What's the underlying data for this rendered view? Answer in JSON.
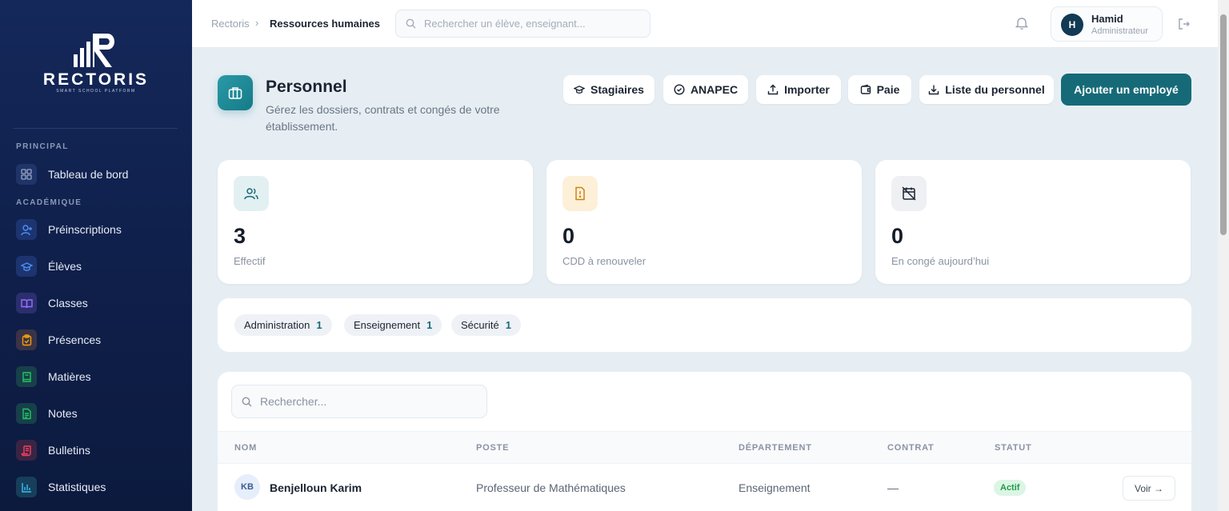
{
  "brand": {
    "name": "RECTORIS",
    "tagline": "SMART SCHOOL PLATFORM"
  },
  "sidebar": {
    "sections": [
      {
        "label": "PRINCIPAL"
      },
      {
        "label": "ACADÉMIQUE"
      }
    ],
    "items": [
      {
        "label": "Tableau de bord",
        "icon": "grid-icon"
      },
      {
        "label": "Préinscriptions",
        "icon": "user-plus-icon"
      },
      {
        "label": "Élèves",
        "icon": "graduation-cap-icon"
      },
      {
        "label": "Classes",
        "icon": "book-open-icon"
      },
      {
        "label": "Présences",
        "icon": "clipboard-check-icon"
      },
      {
        "label": "Matières",
        "icon": "book-icon"
      },
      {
        "label": "Notes",
        "icon": "file-text-icon"
      },
      {
        "label": "Bulletins",
        "icon": "scroll-icon"
      },
      {
        "label": "Statistiques",
        "icon": "bar-chart-icon"
      }
    ],
    "colors": {
      "background": "#14285a",
      "grid": "#9aa7c4",
      "user-plus": "#4f8ff7",
      "graduation-cap": "#4f8ff7",
      "book-open": "#9a6bff",
      "clipboard": "#f59e0b",
      "book": "#22c55e",
      "file-text": "#22c55e",
      "scroll": "#f43f5e",
      "bar-chart": "#38bdf8"
    }
  },
  "topbar": {
    "breadcrumb": [
      "Rectoris",
      "Ressources humaines"
    ],
    "search_placeholder": "Rechercher un élève, enseignant...",
    "user": {
      "initial": "H",
      "name": "Hamid",
      "role": "Administrateur"
    }
  },
  "page": {
    "title": "Personnel",
    "subtitle": "Gérez les dossiers, contrats et congés de votre établissement.",
    "actions": [
      "Stagiaires",
      "ANAPEC",
      "Importer",
      "Paie",
      "Liste du personnel"
    ],
    "primary_action": "Ajouter un employé",
    "accent_color": "#166a78"
  },
  "stats": [
    {
      "value": "3",
      "label": "Effectif",
      "icon": "users-icon"
    },
    {
      "value": "0",
      "label": "CDD à renouveler",
      "icon": "alert-file-icon"
    },
    {
      "value": "0",
      "label": "En congé aujourd’hui",
      "icon": "calendar-off-icon"
    }
  ],
  "departments": [
    {
      "name": "Administration",
      "count": "1"
    },
    {
      "name": "Enseignement",
      "count": "1"
    },
    {
      "name": "Sécurité",
      "count": "1"
    }
  ],
  "table": {
    "search_placeholder": "Rechercher...",
    "columns": [
      "NOM",
      "POSTE",
      "DÉPARTEMENT",
      "CONTRAT",
      "STATUT"
    ],
    "rows": [
      {
        "initials": "KB",
        "name": "Benjelloun Karim",
        "poste": "Professeur de Mathématiques",
        "departement": "Enseignement",
        "contrat": "—",
        "statut": "Actif",
        "action": "Voir →"
      }
    ]
  }
}
